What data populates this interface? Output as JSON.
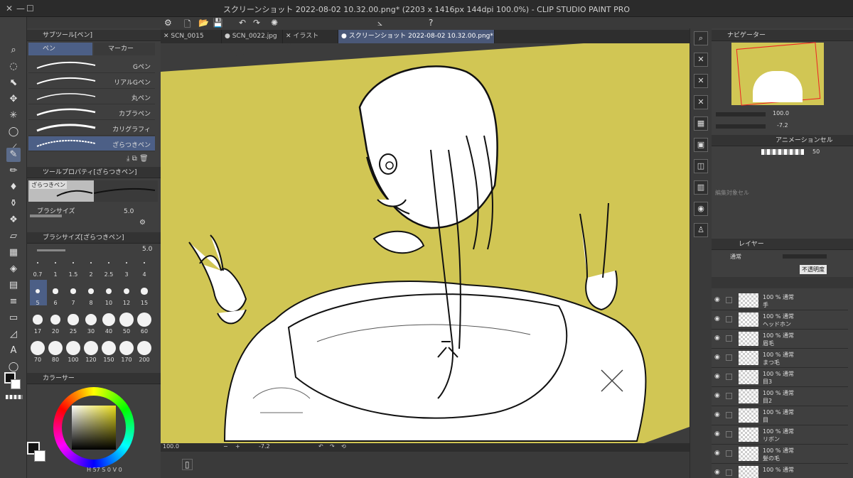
{
  "window": {
    "title": "スクリーンショット 2022-08-02 10.32.00.png* (2203 x 1416px 144dpi 100.0%)  - CLIP STUDIO PAINT PRO"
  },
  "subtool_panel": {
    "title": "サブツール[ペン]",
    "tabs": [
      "ペン",
      "マーカー"
    ],
    "brushes": [
      "Gペン",
      "リアルGペン",
      "丸ペン",
      "カブラペン",
      "カリグラフィ",
      "ざらつきペン"
    ],
    "selected_brush": "ざらつきペン"
  },
  "tool_property": {
    "title": "ツールプロパティ[ざらつきペン]",
    "preview_label": "ざらつきペン",
    "brush_size_label": "ブラシサイズ",
    "brush_size_value": "5.0"
  },
  "brush_size_panel": {
    "title": "ブラシサイズ[ざらつきペン]",
    "value": "5.0",
    "sizes": [
      "0.7",
      "1",
      "1.5",
      "2",
      "2.5",
      "3",
      "4",
      "5",
      "6",
      "7",
      "8",
      "10",
      "12",
      "15",
      "17",
      "20",
      "25",
      "30",
      "40",
      "50",
      "60",
      "70",
      "80",
      "100",
      "120",
      "150",
      "170",
      "200"
    ],
    "selected_size": "5"
  },
  "color_panel": {
    "title": "カラーサー",
    "readout": [
      "H",
      "57",
      "S",
      "0",
      "V",
      "0"
    ]
  },
  "tabs": [
    {
      "label": "SCN_0015",
      "active": false
    },
    {
      "label": "SCN_0022.jpg",
      "active": false
    },
    {
      "label": "イラスト",
      "active": false
    },
    {
      "label": "スクリーンショット 2022-08-02 10.32.00.png*",
      "active": true
    }
  ],
  "status_bar": {
    "zoom": "100.0",
    "rotation": "-7.2"
  },
  "navigator": {
    "title": "ナビゲーター",
    "zoom": "100.0",
    "rotation": "-7.2"
  },
  "animation_cel": {
    "title": "アニメーションセル",
    "opacity_value": "50",
    "edit_target": "編集対象セル"
  },
  "layer_panel": {
    "title": "レイヤー",
    "blend_mode": "通常",
    "opacity_tooltip": "不透明度",
    "layers": [
      {
        "info": "100 % 通常",
        "name": "手"
      },
      {
        "info": "100 % 通常",
        "name": "ヘッドホン"
      },
      {
        "info": "100 % 通常",
        "name": "眉毛"
      },
      {
        "info": "100 % 通常",
        "name": "まつ毛"
      },
      {
        "info": "100 % 通常",
        "name": "目3"
      },
      {
        "info": "100 % 通常",
        "name": "目2"
      },
      {
        "info": "100 % 通常",
        "name": "目"
      },
      {
        "info": "100 % 通常",
        "name": "リボン"
      },
      {
        "info": "100 % 通常",
        "name": "髪の毛"
      },
      {
        "info": "100 % 通常",
        "name": ""
      }
    ]
  },
  "colors": {
    "canvas_bg": "#d1c654",
    "selection": "#4c5f86",
    "panel_bg": "#3f3f3f"
  }
}
